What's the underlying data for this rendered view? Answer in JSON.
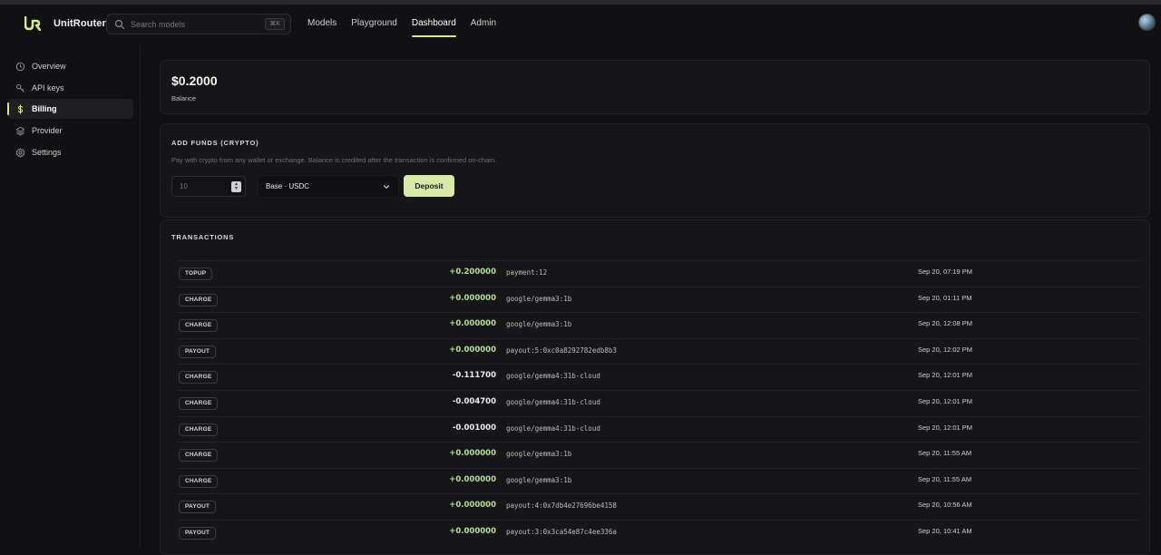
{
  "app": {
    "name": "UnitRouter"
  },
  "search": {
    "placeholder": "Search models",
    "shortcut": "⌘K"
  },
  "nav": {
    "items": [
      {
        "label": "Models"
      },
      {
        "label": "Playground"
      },
      {
        "label": "Dashboard"
      },
      {
        "label": "Admin"
      }
    ],
    "active": "Dashboard"
  },
  "sidebar": {
    "items": [
      {
        "label": "Overview",
        "icon": "clock-icon"
      },
      {
        "label": "API keys",
        "icon": "key-icon"
      },
      {
        "label": "Billing",
        "icon": "dollar-icon"
      },
      {
        "label": "Provider",
        "icon": "layers-icon"
      },
      {
        "label": "Settings",
        "icon": "gear-icon"
      }
    ],
    "active": "Billing"
  },
  "balance": {
    "value": "$0.2000",
    "label": "Balance"
  },
  "add_funds": {
    "title": "ADD FUNDS (CRYPTO)",
    "description": "Pay with crypto from any wallet or exchange. Balance is credited after the transaction is confirmed on-chain.",
    "amount_placeholder": "10",
    "network": "Base · USDC",
    "deposit_label": "Deposit"
  },
  "transactions": {
    "title": "TRANSACTIONS",
    "rows": [
      {
        "type": "TOPUP",
        "amount": "+0.200000",
        "ref": "payment:12",
        "date": "Sep 20, 07:19 PM"
      },
      {
        "type": "CHARGE",
        "amount": "+0.000000",
        "ref": "google/gemma3:1b",
        "date": "Sep 20, 01:11 PM"
      },
      {
        "type": "CHARGE",
        "amount": "+0.000000",
        "ref": "google/gemma3:1b",
        "date": "Sep 20, 12:08 PM"
      },
      {
        "type": "PAYOUT",
        "amount": "+0.000000",
        "ref": "payout:5:0xc0a8292782edb8b3",
        "date": "Sep 20, 12:02 PM"
      },
      {
        "type": "CHARGE",
        "amount": "-0.111700",
        "ref": "google/gemma4:31b-cloud",
        "date": "Sep 20, 12:01 PM"
      },
      {
        "type": "CHARGE",
        "amount": "-0.004700",
        "ref": "google/gemma4:31b-cloud",
        "date": "Sep 20, 12:01 PM"
      },
      {
        "type": "CHARGE",
        "amount": "-0.001000",
        "ref": "google/gemma4:31b-cloud",
        "date": "Sep 20, 12:01 PM"
      },
      {
        "type": "CHARGE",
        "amount": "+0.000000",
        "ref": "google/gemma3:1b",
        "date": "Sep 20, 11:55 AM"
      },
      {
        "type": "CHARGE",
        "amount": "+0.000000",
        "ref": "google/gemma3:1b",
        "date": "Sep 20, 11:55 AM"
      },
      {
        "type": "PAYOUT",
        "amount": "+0.000000",
        "ref": "payout:4:0x7db4e27696be4158",
        "date": "Sep 20, 10:56 AM"
      },
      {
        "type": "PAYOUT",
        "amount": "+0.000000",
        "ref": "payout:3:0x3ca54e87c4ee336a",
        "date": "Sep 20, 10:41 AM"
      }
    ]
  },
  "colors": {
    "accent": "#d5ec8b",
    "positive": "#b8dd9c",
    "background": "#111113",
    "card": "#161618"
  }
}
